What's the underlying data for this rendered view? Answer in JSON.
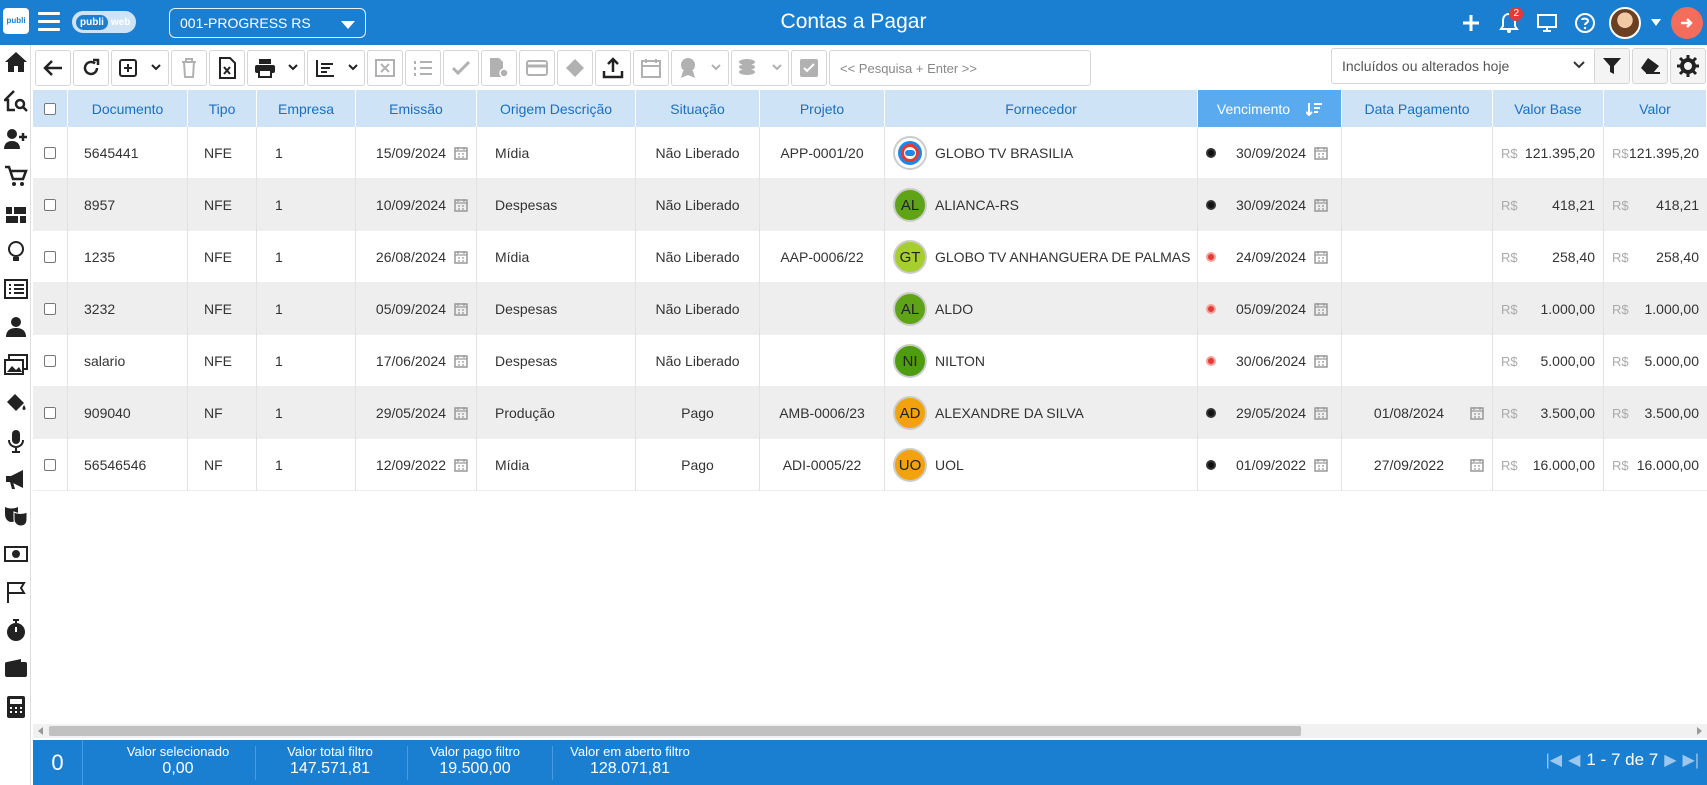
{
  "header": {
    "brand_a": "publi",
    "brand_b": "web",
    "mini_logo": "publi",
    "company": "001-PROGRESS RS",
    "title": "Contas a Pagar",
    "notifications": "2"
  },
  "toolbar": {
    "search_placeholder": "<< Pesquisa + Enter >>",
    "filter_value": "Incluídos ou alterados hoje"
  },
  "columns": [
    "Documento",
    "Tipo",
    "Empresa",
    "Emissão",
    "Origem Descrição",
    "Situação",
    "Projeto",
    "Fornecedor",
    "Vencimento",
    "Data Pagamento",
    "Valor Base",
    "Valor"
  ],
  "currency": "R$",
  "rows": [
    {
      "doc": "5645441",
      "tipo": "NFE",
      "empresa": "1",
      "emissao": "15/09/2024",
      "origem": "Mídia",
      "situacao": "Não Liberado",
      "projeto": "APP-0001/20",
      "fornecedor": "GLOBO TV BRASILIA",
      "initials": "",
      "avatar_color": "#ffffff",
      "status_color": "#111111",
      "vencimento": "30/09/2024",
      "pagamento": "",
      "valor_base": "121.395,20",
      "valor": "121.395,20"
    },
    {
      "doc": "8957",
      "tipo": "NFE",
      "empresa": "1",
      "emissao": "10/09/2024",
      "origem": "Despesas",
      "situacao": "Não Liberado",
      "projeto": "",
      "fornecedor": "ALIANCA-RS",
      "initials": "AL",
      "avatar_color": "#5fa417",
      "status_color": "#111111",
      "vencimento": "30/09/2024",
      "pagamento": "",
      "valor_base": "418,21",
      "valor": "418,21"
    },
    {
      "doc": "1235",
      "tipo": "NFE",
      "empresa": "1",
      "emissao": "26/08/2024",
      "origem": "Mídia",
      "situacao": "Não Liberado",
      "projeto": "AAP-0006/22",
      "fornecedor": "GLOBO TV ANHANGUERA DE PALMAS",
      "initials": "GT",
      "avatar_color": "#a6cf2d",
      "status_color": "#e53935",
      "vencimento": "24/09/2024",
      "pagamento": "",
      "valor_base": "258,40",
      "valor": "258,40"
    },
    {
      "doc": "3232",
      "tipo": "NFE",
      "empresa": "1",
      "emissao": "05/09/2024",
      "origem": "Despesas",
      "situacao": "Não Liberado",
      "projeto": "",
      "fornecedor": "ALDO",
      "initials": "AL",
      "avatar_color": "#5fa417",
      "status_color": "#e53935",
      "vencimento": "05/09/2024",
      "pagamento": "",
      "valor_base": "1.000,00",
      "valor": "1.000,00"
    },
    {
      "doc": "salario",
      "tipo": "NFE",
      "empresa": "1",
      "emissao": "17/06/2024",
      "origem": "Despesas",
      "situacao": "Não Liberado",
      "projeto": "",
      "fornecedor": "NILTON",
      "initials": "NI",
      "avatar_color": "#4e9d0f",
      "status_color": "#e53935",
      "vencimento": "30/06/2024",
      "pagamento": "",
      "valor_base": "5.000,00",
      "valor": "5.000,00"
    },
    {
      "doc": "909040",
      "tipo": "NF",
      "empresa": "1",
      "emissao": "29/05/2024",
      "origem": "Produção",
      "situacao": "Pago",
      "projeto": "AMB-0006/23",
      "fornecedor": "ALEXANDRE DA SILVA",
      "initials": "AD",
      "avatar_color": "#f2a20c",
      "status_color": "#111111",
      "vencimento": "29/05/2024",
      "pagamento": "01/08/2024",
      "valor_base": "3.500,00",
      "valor": "3.500,00"
    },
    {
      "doc": "56546546",
      "tipo": "NF",
      "empresa": "1",
      "emissao": "12/09/2022",
      "origem": "Mídia",
      "situacao": "Pago",
      "projeto": "ADI-0005/22",
      "fornecedor": "UOL",
      "initials": "UO",
      "avatar_color": "#f2a20c",
      "status_color": "#111111",
      "vencimento": "01/09/2022",
      "pagamento": "27/09/2022",
      "valor_base": "16.000,00",
      "valor": "16.000,00"
    }
  ],
  "footer": {
    "selected_count": "0",
    "valor_selecionado_label": "Valor selecionado",
    "valor_selecionado": "0,00",
    "valor_total_label": "Valor total filtro",
    "valor_total": "147.571,81",
    "valor_pago_label": "Valor pago filtro",
    "valor_pago": "19.500,00",
    "valor_aberto_label": "Valor em aberto filtro",
    "valor_aberto": "128.071,81",
    "pagination": "1 - 7 de 7"
  },
  "colors": {
    "primary": "#1b7fd1",
    "header_row": "#cfe3f6",
    "sorted_header": "#5aaaf0"
  }
}
